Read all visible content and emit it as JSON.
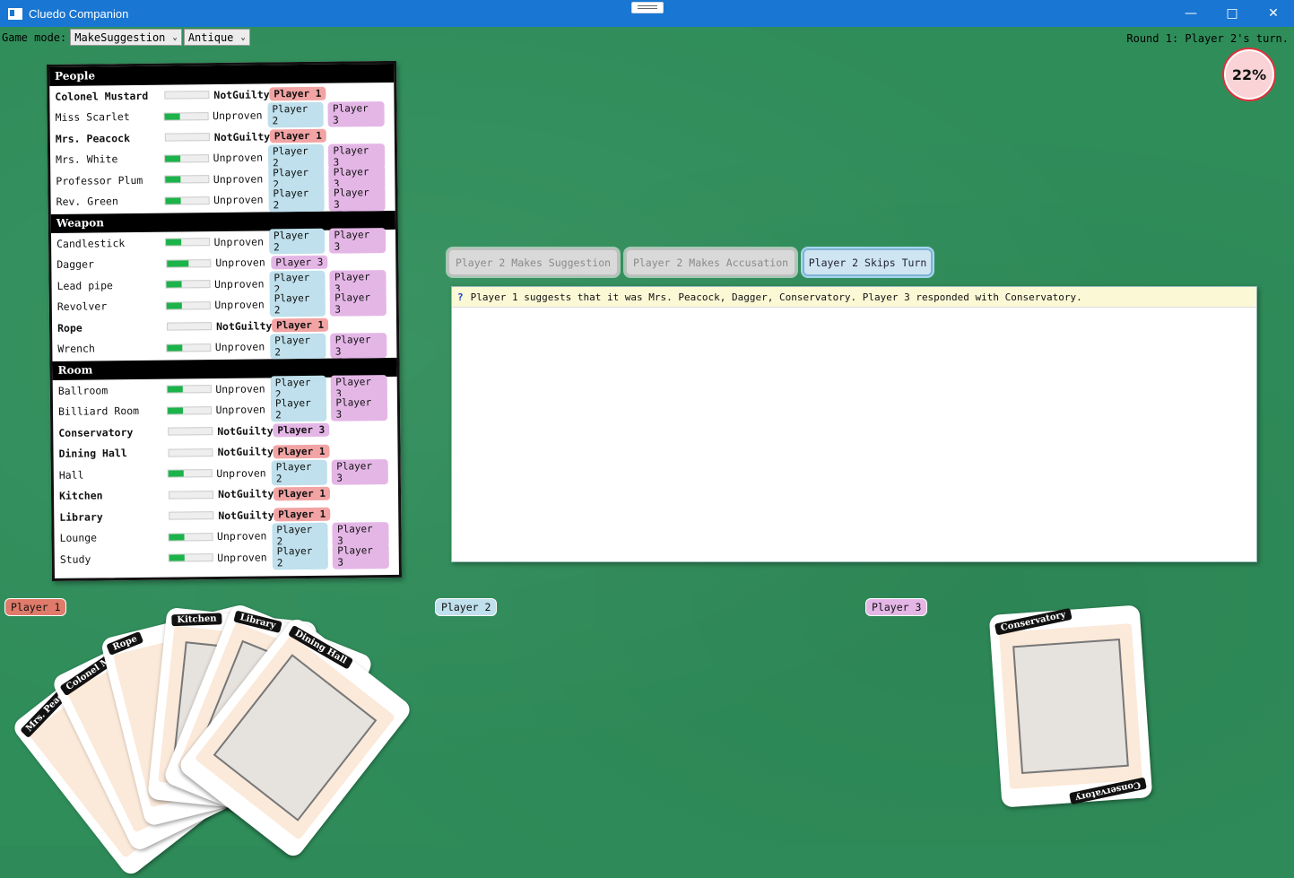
{
  "window": {
    "title": "Cluedo Companion"
  },
  "toolbar": {
    "mode_label": "Game mode:",
    "mode_value": "MakeSuggestion",
    "theme_value": "Antique"
  },
  "status": {
    "round_text": "Round 1: Player 2's turn.",
    "progress": "22%"
  },
  "checklist": {
    "people": {
      "header": "People",
      "rows": [
        {
          "name": "Colonel Mustard",
          "status": "NotGuilty",
          "bold": true,
          "fill": 0,
          "pills": [
            "Player 1"
          ]
        },
        {
          "name": "Miss Scarlet",
          "status": "Unproven",
          "fill": 0.35,
          "pills": [
            "Player 2",
            "Player 3"
          ]
        },
        {
          "name": "Mrs. Peacock",
          "status": "NotGuilty",
          "bold": true,
          "fill": 0,
          "pills": [
            "Player 1"
          ]
        },
        {
          "name": "Mrs. White",
          "status": "Unproven",
          "fill": 0.35,
          "pills": [
            "Player 2",
            "Player 3"
          ]
        },
        {
          "name": "Professor Plum",
          "status": "Unproven",
          "fill": 0.35,
          "pills": [
            "Player 2",
            "Player 3"
          ]
        },
        {
          "name": "Rev. Green",
          "status": "Unproven",
          "fill": 0.35,
          "pills": [
            "Player 2",
            "Player 3"
          ]
        }
      ]
    },
    "weapon": {
      "header": "Weapon",
      "rows": [
        {
          "name": "Candlestick",
          "status": "Unproven",
          "fill": 0.35,
          "pills": [
            "Player 2",
            "Player 3"
          ]
        },
        {
          "name": "Dagger",
          "status": "Unproven",
          "fill": 0.5,
          "pills": [
            "Player 3"
          ]
        },
        {
          "name": "Lead pipe",
          "status": "Unproven",
          "fill": 0.35,
          "pills": [
            "Player 2",
            "Player 3"
          ]
        },
        {
          "name": "Revolver",
          "status": "Unproven",
          "fill": 0.35,
          "pills": [
            "Player 2",
            "Player 3"
          ]
        },
        {
          "name": "Rope",
          "status": "NotGuilty",
          "bold": true,
          "fill": 0,
          "pills": [
            "Player 1"
          ]
        },
        {
          "name": "Wrench",
          "status": "Unproven",
          "fill": 0.35,
          "pills": [
            "Player 2",
            "Player 3"
          ]
        }
      ]
    },
    "room": {
      "header": "Room",
      "rows": [
        {
          "name": "Ballroom",
          "status": "Unproven",
          "fill": 0.35,
          "pills": [
            "Player 2",
            "Player 3"
          ]
        },
        {
          "name": "Billiard Room",
          "status": "Unproven",
          "fill": 0.35,
          "pills": [
            "Player 2",
            "Player 3"
          ]
        },
        {
          "name": "Conservatory",
          "status": "NotGuilty",
          "bold": true,
          "fill": 0,
          "pills": [
            "Player 3"
          ]
        },
        {
          "name": "Dining Hall",
          "status": "NotGuilty",
          "bold": true,
          "fill": 0,
          "pills": [
            "Player 1"
          ]
        },
        {
          "name": "Hall",
          "status": "Unproven",
          "fill": 0.35,
          "pills": [
            "Player 2",
            "Player 3"
          ]
        },
        {
          "name": "Kitchen",
          "status": "NotGuilty",
          "bold": true,
          "fill": 0,
          "pills": [
            "Player 1"
          ]
        },
        {
          "name": "Library",
          "status": "NotGuilty",
          "bold": true,
          "fill": 0,
          "pills": [
            "Player 1"
          ]
        },
        {
          "name": "Lounge",
          "status": "Unproven",
          "fill": 0.35,
          "pills": [
            "Player 2",
            "Player 3"
          ]
        },
        {
          "name": "Study",
          "status": "Unproven",
          "fill": 0.35,
          "pills": [
            "Player 2",
            "Player 3"
          ]
        }
      ]
    }
  },
  "actions": {
    "suggestion": "Player 2 Makes Suggestion",
    "accusation": "Player 2 Makes Accusation",
    "skip": "Player 2 Skips Turn"
  },
  "log": {
    "entries": [
      {
        "icon": "?",
        "text": "Player 1 suggests that it was Mrs. Peacock, Dagger, Conservatory. Player 3 responded with Conservatory."
      }
    ]
  },
  "players": {
    "p1": "Player 1",
    "p2": "Player 2",
    "p3": "Player 3"
  },
  "hands": {
    "player1": [
      "Mrs. Peacock",
      "Colonel Mustard",
      "Rope",
      "Kitchen",
      "Library",
      "Dining Hall"
    ],
    "player3": [
      "Conservatory"
    ]
  },
  "colors": {
    "player1": "#f2a3a3",
    "player2": "#bfe0ec",
    "player3": "#e4b6e6",
    "felt": "#2f8d5a",
    "bar": "#1bb34a"
  }
}
